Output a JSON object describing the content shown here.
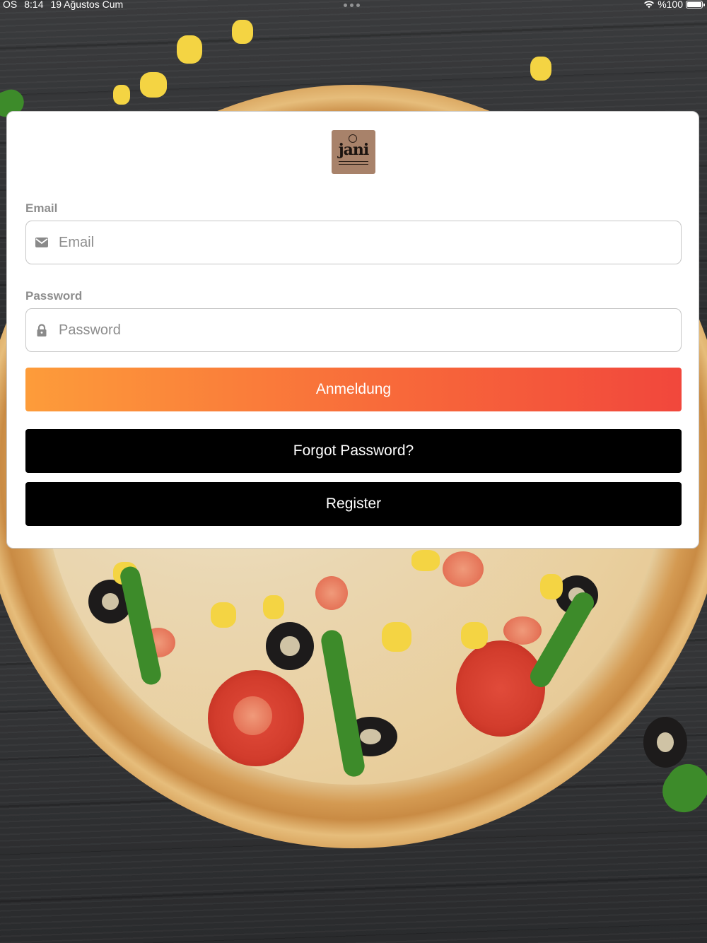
{
  "status_bar": {
    "carrier": "OS",
    "time": "8:14",
    "date": "19 Ağustos Cum",
    "battery": "%100",
    "battery_level": 1.0,
    "icons": [
      "wifi-icon",
      "battery-icon"
    ]
  },
  "logo": {
    "text": "jani",
    "color": "#a8826a"
  },
  "login_form": {
    "email": {
      "label": "Email",
      "placeholder": "Email",
      "value": "",
      "icon": "envelope-icon"
    },
    "password": {
      "label": "Password",
      "placeholder": "Password",
      "value": "",
      "icon": "lock-icon"
    },
    "login_button": "Anmeldung",
    "forgot_button": "Forgot Password?",
    "register_button": "Register"
  },
  "colors": {
    "login_gradient_start": "#fd9c3a",
    "login_gradient_end": "#f1473c",
    "dark_button": "#000000",
    "label_gray": "#8e8e8e"
  }
}
